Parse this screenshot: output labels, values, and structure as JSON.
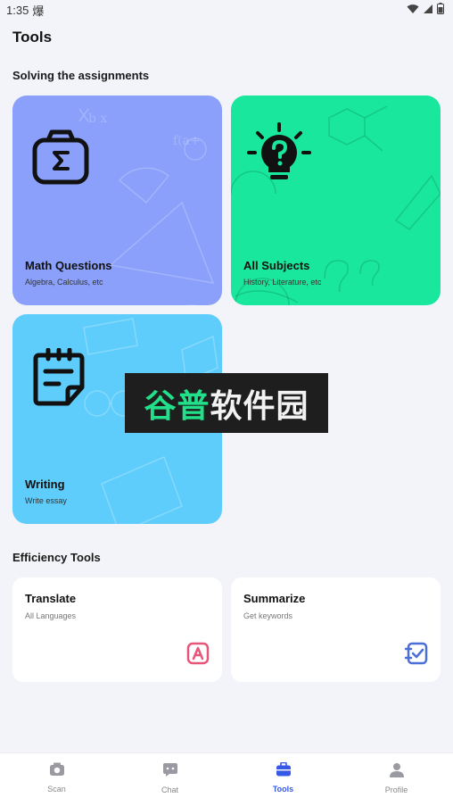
{
  "status_bar": {
    "time": "1:35",
    "extra": "爆"
  },
  "page": {
    "title": "Tools"
  },
  "sections": {
    "solving": "Solving the assignments",
    "efficiency": "Efficiency Tools"
  },
  "assignments": [
    {
      "title": "Math Questions",
      "subtitle": "Algebra, Calculus, etc",
      "icon": "sigma-camera-icon",
      "color": "#8aa0fb"
    },
    {
      "title": "All Subjects",
      "subtitle": "History, Literature, etc",
      "icon": "lightbulb-question-icon",
      "color": "#18e79d"
    },
    {
      "title": "Writing",
      "subtitle": "Write essay",
      "icon": "notepad-icon",
      "color": "#5ecdfb"
    }
  ],
  "efficiency": [
    {
      "title": "Translate",
      "subtitle": "All Languages",
      "icon": "translate-icon",
      "color": "#e8547a"
    },
    {
      "title": "Summarize",
      "subtitle": "Get keywords",
      "icon": "summarize-icon",
      "color": "#4a6fd8"
    }
  ],
  "watermark": {
    "green": "谷普",
    "white": "软件园"
  },
  "nav": [
    {
      "label": "Scan",
      "icon": "camera-icon"
    },
    {
      "label": "Chat",
      "icon": "chat-icon"
    },
    {
      "label": "Tools",
      "icon": "toolbox-icon",
      "active": true
    },
    {
      "label": "Profile",
      "icon": "person-icon"
    }
  ]
}
